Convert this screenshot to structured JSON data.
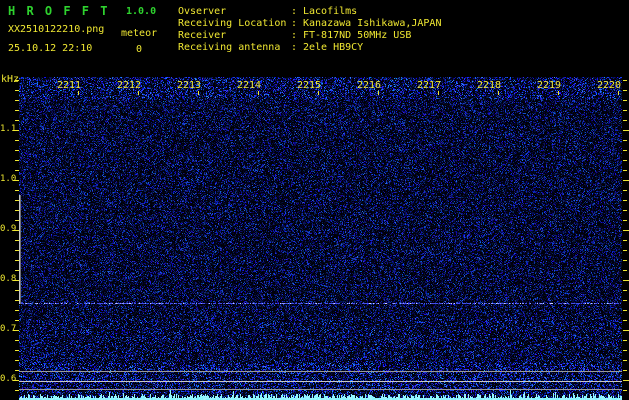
{
  "app": {
    "title": "H R O F F T",
    "version": "1.0.0",
    "filename": "XX2510122210.png",
    "mode_label": "meteor",
    "meteor_count": "0",
    "datetime": "25.10.12 22:10"
  },
  "info": {
    "rows": [
      {
        "label": "Ovserver",
        "value": "Lacofilms"
      },
      {
        "label": "Receiving Location",
        "value": "Kanazawa Ishikawa,JAPAN"
      },
      {
        "label": "Receiver",
        "value": "FT-817ND 50MHz USB"
      },
      {
        "label": "Receiving antenna",
        "value": "2ele HB9CY"
      }
    ]
  },
  "chart_data": {
    "type": "heatmap",
    "subtype": "radio-meteor-spectrogram",
    "x_axis": {
      "tick_labels": [
        "2211",
        "2212",
        "2213",
        "2214",
        "2215",
        "2216",
        "2217",
        "2218",
        "2219",
        "2220"
      ],
      "span_minutes": 10
    },
    "y_axis": {
      "unit": "kHz",
      "tick_labels": [
        "1.1",
        "1.0",
        "0.9",
        "0.8",
        "0.7",
        "0.6"
      ],
      "tick_values": [
        1.1,
        1.0,
        0.9,
        0.8,
        0.7,
        0.6
      ],
      "min": 0.56,
      "max": 1.21,
      "minor_step_khz": 0.02
    },
    "legend": "none",
    "grid": "off",
    "features": [
      {
        "name": "background-noise",
        "description": "uniform faint blue speckle noise, no meteor echoes visible"
      },
      {
        "name": "carrier-dashed-line",
        "freq_khz": 0.754,
        "style": "dashed",
        "color": "#6470ff"
      },
      {
        "name": "horizontal-line-1",
        "freq_khz": 0.618,
        "style": "solid",
        "color": "#9a9a9a"
      },
      {
        "name": "horizontal-line-2",
        "freq_khz": 0.598,
        "style": "solid",
        "color": "#c8c8c8"
      },
      {
        "name": "horizontal-line-3",
        "freq_khz": 0.582,
        "style": "solid",
        "color": "#9a9a9a"
      },
      {
        "name": "left-edge-vertical-marker",
        "freq_from_khz": 0.97,
        "freq_to_khz": 0.754,
        "style": "solid",
        "color": "#c8c8c8"
      },
      {
        "name": "noise-level-trace",
        "position": "bottom-edge",
        "color": "#8ff4ff"
      }
    ]
  },
  "colors": {
    "background": "#000000",
    "title_green": "#2ed22e",
    "text_yellow": "#f0e832",
    "noise_blue": "#2030c8",
    "trace_cyan": "#8ff4ff"
  }
}
